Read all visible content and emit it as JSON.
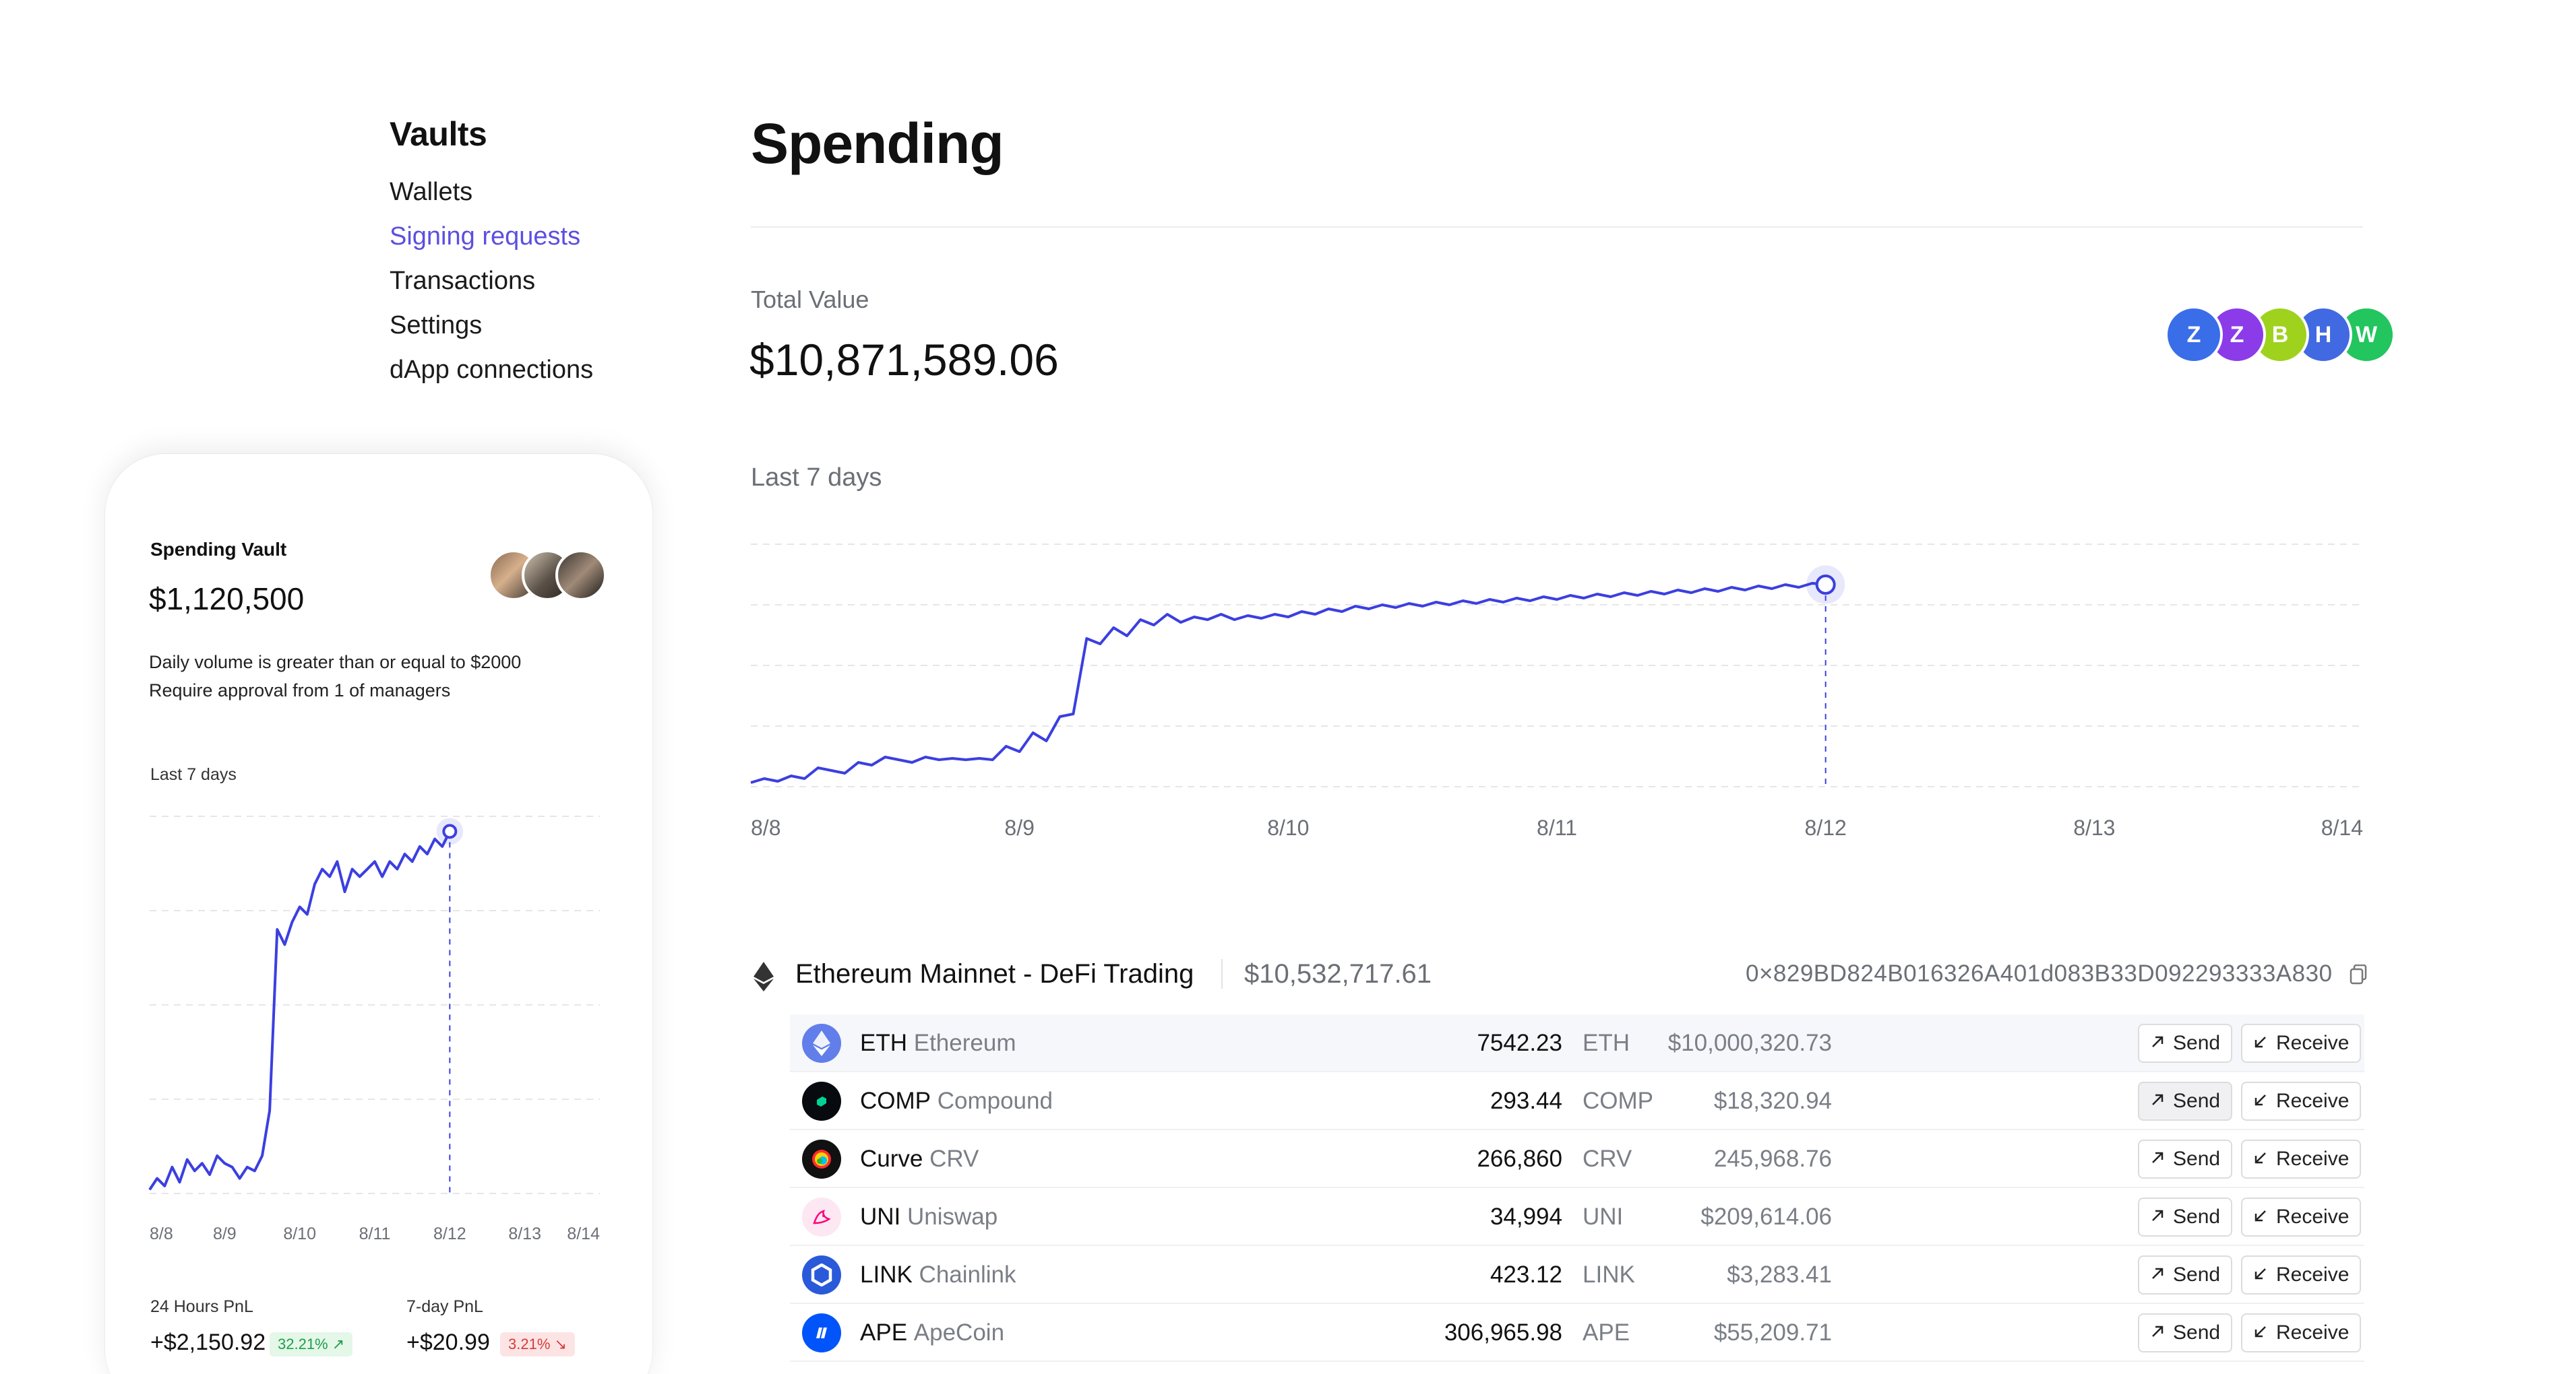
{
  "sidebar": {
    "title": "Vaults",
    "items": [
      {
        "label": "Wallets",
        "active": false
      },
      {
        "label": "Signing requests",
        "active": true
      },
      {
        "label": "Transactions",
        "active": false
      },
      {
        "label": "Settings",
        "active": false
      },
      {
        "label": "dApp connections",
        "active": false
      }
    ]
  },
  "vault_card": {
    "title": "Spending Vault",
    "amount": "$1,120,500",
    "rule_line1": "Daily volume is greater than or equal to $2000",
    "rule_line2": "Require approval from 1 of managers",
    "chart_label": "Last 7 days",
    "pnl_24h_label": "24 Hours PnL",
    "pnl_24h_value": "+$2,150.92",
    "pnl_24h_pct": "32.21% ↗",
    "pnl_7d_label": "7-day PnL",
    "pnl_7d_value": "+$20.99",
    "pnl_7d_pct": "3.21% ↘",
    "colors": {
      "up_bg": "#e4f7e8",
      "up_fg": "#1e9e4a",
      "down_bg": "#fde4e4",
      "down_fg": "#d63b3b"
    }
  },
  "page": {
    "title": "Spending",
    "total_label": "Total Value",
    "total_value": "$10,871,589.06",
    "members": [
      {
        "initial": "Z",
        "color": "#3a6ee8"
      },
      {
        "initial": "Z",
        "color": "#8b3ce8"
      },
      {
        "initial": "B",
        "color": "#9fd21d"
      },
      {
        "initial": "H",
        "color": "#4169e1"
      },
      {
        "initial": "W",
        "color": "#22c55e"
      }
    ],
    "chart_label": "Last 7 days",
    "accent": "#3b3fe0"
  },
  "chart_data": [
    {
      "type": "line",
      "title": "",
      "x": [
        "8/8",
        "8/9",
        "8/10",
        "8/11",
        "8/12",
        "8/13",
        "8/14"
      ],
      "series": [
        {
          "values_t": [
            0.0,
            0.05,
            0.1,
            0.15,
            0.2,
            0.25,
            0.3,
            0.35,
            0.4,
            0.45,
            0.5,
            0.55,
            0.6,
            0.65,
            0.7,
            0.75,
            0.8,
            0.85,
            0.9,
            0.95,
            1.0,
            1.05,
            1.1,
            1.15,
            1.2,
            1.25,
            1.3,
            1.35,
            1.4,
            1.45,
            1.5,
            1.55,
            1.6,
            1.65,
            1.7,
            1.75,
            1.8,
            1.85,
            1.9,
            1.95,
            2.0,
            2.05,
            2.1,
            2.15,
            2.2,
            2.25,
            2.3,
            2.35,
            2.4,
            2.45,
            2.5,
            2.55,
            2.6,
            2.65,
            2.7,
            2.75,
            2.8,
            2.85,
            2.9,
            2.95,
            3.0,
            3.05,
            3.1,
            3.15,
            3.2,
            3.25,
            3.3,
            3.35,
            3.4,
            3.45,
            3.5,
            3.55,
            3.6,
            3.65,
            3.7,
            3.75,
            3.8,
            3.85,
            3.9,
            3.95,
            4.0
          ],
          "values": [
            3,
            6,
            4,
            8,
            6,
            14,
            12,
            10,
            18,
            16,
            22,
            20,
            18,
            22,
            20,
            21,
            20,
            21,
            20,
            30,
            26,
            40,
            34,
            52,
            54,
            110,
            106,
            118,
            112,
            124,
            120,
            128,
            122,
            126,
            124,
            128,
            124,
            127,
            125,
            128,
            126,
            130,
            128,
            132,
            130,
            134,
            132,
            135,
            133,
            136,
            134,
            137,
            135,
            138,
            136,
            139,
            137,
            140,
            138,
            141,
            139,
            142,
            140,
            143,
            141,
            144,
            142,
            145,
            143,
            146,
            144,
            147,
            145,
            148,
            146,
            149,
            147,
            150,
            148,
            151,
            150
          ]
        }
      ],
      "highlight_x": "8/12"
    },
    {
      "type": "line",
      "title": "",
      "x": [
        "8/8",
        "8/9",
        "8/10",
        "8/11",
        "8/12",
        "8/13",
        "8/14"
      ],
      "series": [
        {
          "values_t": [
            0.0,
            0.1,
            0.2,
            0.3,
            0.4,
            0.5,
            0.6,
            0.7,
            0.8,
            0.9,
            1.0,
            1.1,
            1.2,
            1.3,
            1.4,
            1.5,
            1.6,
            1.7,
            1.8,
            1.9,
            2.0,
            2.1,
            2.2,
            2.3,
            2.4,
            2.5,
            2.6,
            2.7,
            2.8,
            2.9,
            3.0,
            3.1,
            3.2,
            3.3,
            3.4,
            3.5,
            3.6,
            3.7,
            3.8,
            3.9,
            4.0
          ],
          "values": [
            1,
            4,
            2,
            7,
            3,
            9,
            6,
            8,
            5,
            10,
            8,
            7,
            4,
            7,
            6,
            10,
            22,
            70,
            66,
            72,
            76,
            74,
            82,
            86,
            84,
            88,
            80,
            86,
            84,
            86,
            88,
            84,
            88,
            86,
            90,
            88,
            92,
            90,
            94,
            92,
            96
          ]
        }
      ],
      "highlight_x": "8/12"
    }
  ],
  "wallet": {
    "name": "Ethereum Mainnet - DeFi Trading",
    "value": "$10,532,717.61",
    "address": "0×829BD824B016326A401d083B33D092293333A830",
    "send_label": "Send",
    "receive_label": "Receive",
    "assets": [
      {
        "symbol": "ETH",
        "name": "Ethereum",
        "qty": "7542.23",
        "unit": "ETH",
        "usd": "$10,000,320.73",
        "icon": "eth-icon",
        "color": "#627eea"
      },
      {
        "symbol": "COMP",
        "name": "Compound",
        "qty": "293.44",
        "unit": "COMP",
        "usd": "$18,320.94",
        "icon": "compound-icon",
        "color": "#070a0e"
      },
      {
        "symbol": "Curve",
        "name": "CRV",
        "qty": "266,860",
        "unit": "CRV",
        "usd": "245,968.76",
        "icon": "curve-icon",
        "color": "#111111"
      },
      {
        "symbol": "UNI",
        "name": "Uniswap",
        "qty": "34,994",
        "unit": "UNI",
        "usd": "$209,614.06",
        "icon": "uniswap-icon",
        "color": "#ff007a"
      },
      {
        "symbol": "LINK",
        "name": "Chainlink",
        "qty": "423.12",
        "unit": "LINK",
        "usd": "$3,283.41",
        "icon": "chainlink-icon",
        "color": "#2a5ada"
      },
      {
        "symbol": "APE",
        "name": "ApeCoin",
        "qty": "306,965.98",
        "unit": "APE",
        "usd": "$55,209.71",
        "icon": "apecoin-icon",
        "color": "#0054f9"
      }
    ]
  }
}
